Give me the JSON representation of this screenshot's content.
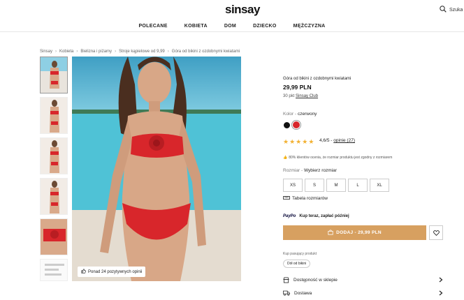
{
  "header": {
    "logo": "sinsay",
    "search_label": "Szuka",
    "nav": [
      "POLECANE",
      "KOBIETA",
      "DOM",
      "DZIECKO",
      "MĘŻCZYZNA"
    ]
  },
  "breadcrumbs": [
    "Sinsay",
    "Kobieta",
    "Bielizna i piżamy",
    "Stroje kąpielowe od 9,99",
    "Góra od bikini z ozdobnymi kwiatami"
  ],
  "gallery": {
    "reviews_badge": "Ponad 24 pozytywnych opinii"
  },
  "product": {
    "name": "Góra od bikini z ozdobnymi kwiatami",
    "price": "29,99 PLN",
    "club_prefix": "30 pkt",
    "club_link": "Sinsay Club",
    "color_label": "Kolor -",
    "color_value": "czerwony",
    "colors": [
      "#111111",
      "#d8262b"
    ],
    "rating_value": "4,6/5",
    "rating_sep": "-",
    "reviews_link": "opinie (27)",
    "fit_note": "80% klientów ocenia, że rozmiar produktu jest zgodny z rozmiarem",
    "size_label": "Rozmiar -",
    "size_value": "Wybierz rozmiar",
    "sizes": [
      "XS",
      "S",
      "M",
      "L",
      "XL"
    ],
    "size_table": "Tabela rozmiarów",
    "paypo_logo": "PayPo",
    "paypo_text": "Kup teraz, zapłać później",
    "add_button": "DODAJ - 29,99 PLN",
    "set_label": "Kup pasujący produkt",
    "set_chip": "Dół od bikini",
    "availability": "Dostępność w sklepie",
    "delivery": "Dostawa"
  },
  "colors": {
    "accent": "#d7a060",
    "star": "#f2b132",
    "selected_color": "#d8262b"
  }
}
